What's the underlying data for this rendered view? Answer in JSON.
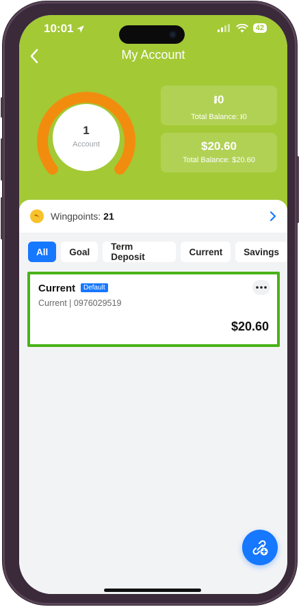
{
  "status_bar": {
    "time": "10:01",
    "battery": "42"
  },
  "header": {
    "title": "My Account"
  },
  "summary": {
    "account_count": "1",
    "account_label": "Account",
    "cards": [
      {
        "amount": "៛0",
        "label": "Total Balance: ៛0"
      },
      {
        "amount": "$20.60",
        "label": "Total Balance: $20.60"
      }
    ]
  },
  "wingpoints": {
    "label": "Wingpoints:",
    "value": "21"
  },
  "filters": [
    "All",
    "Goal",
    "Term Deposit",
    "Current",
    "Savings"
  ],
  "account": {
    "title": "Current",
    "badge": "Default",
    "subtitle": "Current | 0976029519",
    "amount": "$20.60"
  },
  "icons": {
    "back": "chevron-left-icon",
    "more": "more-horizontal-icon",
    "wingpoints": "coin-icon",
    "fab": "link-add-icon",
    "location": "location-arrow-icon"
  },
  "colors": {
    "header_green": "#a3c935",
    "donut_orange": "#f28c0f",
    "accent_blue": "#1677ff",
    "highlight_green": "#49b217"
  }
}
